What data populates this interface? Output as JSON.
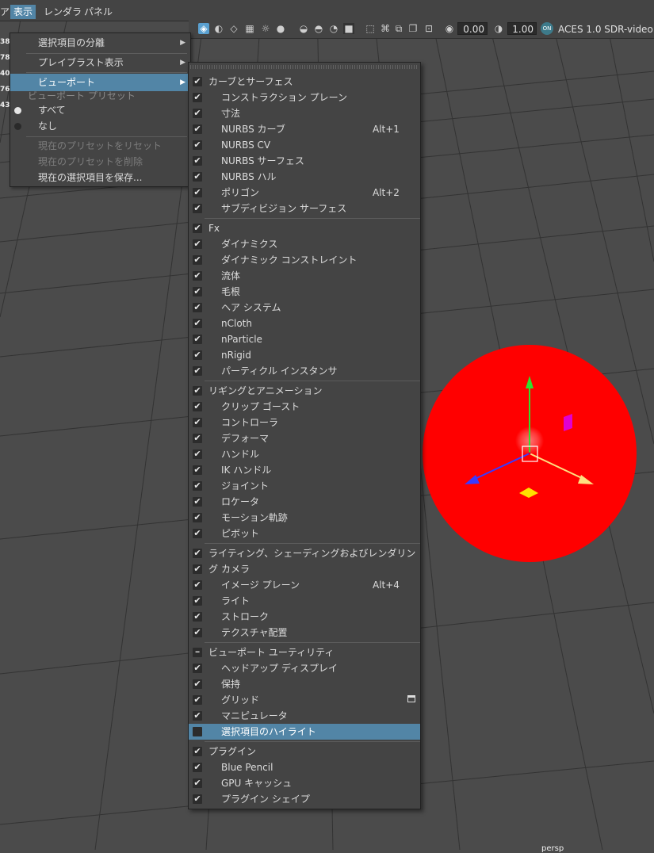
{
  "menubar": {
    "items": [
      "ア",
      "表示",
      "レンダラ",
      "パネル"
    ],
    "active_index": 1
  },
  "left_numbers": [
    "38",
    "78",
    "40",
    "76",
    "43"
  ],
  "toolbar": {
    "exposure": "0.00",
    "gamma": "1.00",
    "color_space": "ACES 1.0 SDR-video",
    "badge": "ON"
  },
  "menu1": {
    "items": [
      {
        "label": "選択項目の分離",
        "submenu": true
      },
      {
        "label": "プレイブラスト表示",
        "submenu": true
      },
      {
        "label": "ビューポート",
        "submenu": true,
        "selected": true
      }
    ],
    "preset_title": "ビューポート プリセット",
    "presets": [
      {
        "label": "すべて",
        "checked": true
      },
      {
        "label": "なし",
        "checked": false
      }
    ],
    "actions": [
      {
        "label": "現在のプリセットをリセット",
        "enabled": false
      },
      {
        "label": "現在のプリセットを削除",
        "enabled": false
      },
      {
        "label": "現在の選択項目を保存...",
        "enabled": true
      }
    ]
  },
  "submenu": {
    "rows": [
      {
        "label": "カーブとサーフェス",
        "kind": "section",
        "state": "checked"
      },
      {
        "label": "コンストラクション プレーン",
        "kind": "item",
        "state": "checked"
      },
      {
        "label": "寸法",
        "kind": "item",
        "state": "checked"
      },
      {
        "label": "NURBS カーブ",
        "kind": "item",
        "state": "checked",
        "shortcut": "Alt+1"
      },
      {
        "label": "NURBS CV",
        "kind": "item",
        "state": "checked"
      },
      {
        "label": "NURBS サーフェス",
        "kind": "item",
        "state": "checked"
      },
      {
        "label": "NURBS ハル",
        "kind": "item",
        "state": "checked"
      },
      {
        "label": "ポリゴン",
        "kind": "item",
        "state": "checked",
        "shortcut": "Alt+2"
      },
      {
        "label": "サブディビジョン サーフェス",
        "kind": "item",
        "state": "checked"
      },
      {
        "label": "Fx",
        "kind": "section",
        "state": "checked"
      },
      {
        "label": "ダイナミクス",
        "kind": "item",
        "state": "checked"
      },
      {
        "label": "ダイナミック コンストレイント",
        "kind": "item",
        "state": "checked"
      },
      {
        "label": "流体",
        "kind": "item",
        "state": "checked"
      },
      {
        "label": "毛根",
        "kind": "item",
        "state": "checked"
      },
      {
        "label": "ヘア システム",
        "kind": "item",
        "state": "checked"
      },
      {
        "label": "nCloth",
        "kind": "item",
        "state": "checked"
      },
      {
        "label": "nParticle",
        "kind": "item",
        "state": "checked"
      },
      {
        "label": "nRigid",
        "kind": "item",
        "state": "checked"
      },
      {
        "label": "パーティクル インスタンサ",
        "kind": "item",
        "state": "checked"
      },
      {
        "label": "リギングとアニメーション",
        "kind": "section",
        "state": "checked"
      },
      {
        "label": "クリップ ゴースト",
        "kind": "item",
        "state": "checked"
      },
      {
        "label": "コントローラ",
        "kind": "item",
        "state": "checked"
      },
      {
        "label": "デフォーマ",
        "kind": "item",
        "state": "checked"
      },
      {
        "label": "ハンドル",
        "kind": "item",
        "state": "checked"
      },
      {
        "label": "IK ハンドル",
        "kind": "item",
        "state": "checked"
      },
      {
        "label": "ジョイント",
        "kind": "item",
        "state": "checked"
      },
      {
        "label": "ロケータ",
        "kind": "item",
        "state": "checked"
      },
      {
        "label": "モーション軌跡",
        "kind": "item",
        "state": "checked"
      },
      {
        "label": "ピボット",
        "kind": "item",
        "state": "checked"
      },
      {
        "label": "ライティング、シェーディングおよびレンダリング",
        "kind": "section",
        "state": "checked"
      },
      {
        "label": "カメラ",
        "kind": "item",
        "state": "checked"
      },
      {
        "label": "イメージ プレーン",
        "kind": "item",
        "state": "checked",
        "shortcut": "Alt+4"
      },
      {
        "label": "ライト",
        "kind": "item",
        "state": "checked"
      },
      {
        "label": "ストローク",
        "kind": "item",
        "state": "checked"
      },
      {
        "label": "テクスチャ配置",
        "kind": "item",
        "state": "checked"
      },
      {
        "label": "ビューポート ユーティリティ",
        "kind": "section",
        "state": "partial"
      },
      {
        "label": "ヘッドアップ ディスプレイ",
        "kind": "item",
        "state": "checked"
      },
      {
        "label": "保持",
        "kind": "item",
        "state": "checked"
      },
      {
        "label": "グリッド",
        "kind": "item",
        "state": "checked",
        "option_box": true
      },
      {
        "label": "マニピュレータ",
        "kind": "item",
        "state": "checked"
      },
      {
        "label": "選択項目のハイライト",
        "kind": "item",
        "state": "unchecked",
        "highlighted": true
      },
      {
        "label": "プラグイン",
        "kind": "section",
        "state": "checked"
      },
      {
        "label": "Blue Pencil",
        "kind": "item",
        "state": "checked"
      },
      {
        "label": "GPU キャッシュ",
        "kind": "item",
        "state": "checked"
      },
      {
        "label": "プラグイン シェイプ",
        "kind": "item",
        "state": "checked"
      }
    ]
  },
  "scene": {
    "sphere_color": "#ff0000",
    "camera_label": "persp"
  }
}
